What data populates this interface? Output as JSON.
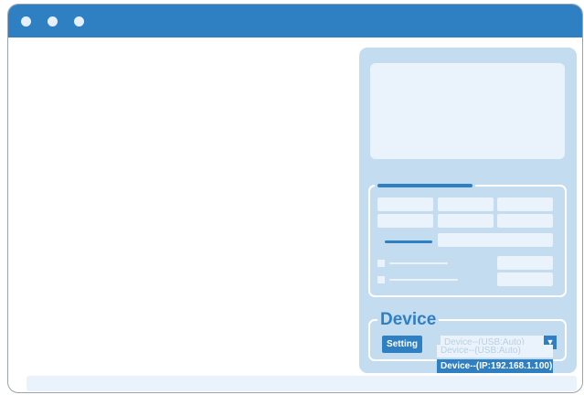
{
  "window": {
    "colors": {
      "titlebar": "#2f7fc3",
      "panel": "#c4dcf0",
      "field": "#eaf3fb"
    },
    "titlebar_dots": [
      "close-dot",
      "minimize-dot",
      "maximize-dot"
    ]
  },
  "device": {
    "title": "Device",
    "setting_label": "Setting",
    "selected": "Device--(USB:Auto)",
    "arrow": "▼",
    "options": [
      "Device--(USB:Auto)",
      "Device--(IP:192.168.1.100)"
    ],
    "highlighted_option": "Device--(IP:192.168.1.100)"
  }
}
